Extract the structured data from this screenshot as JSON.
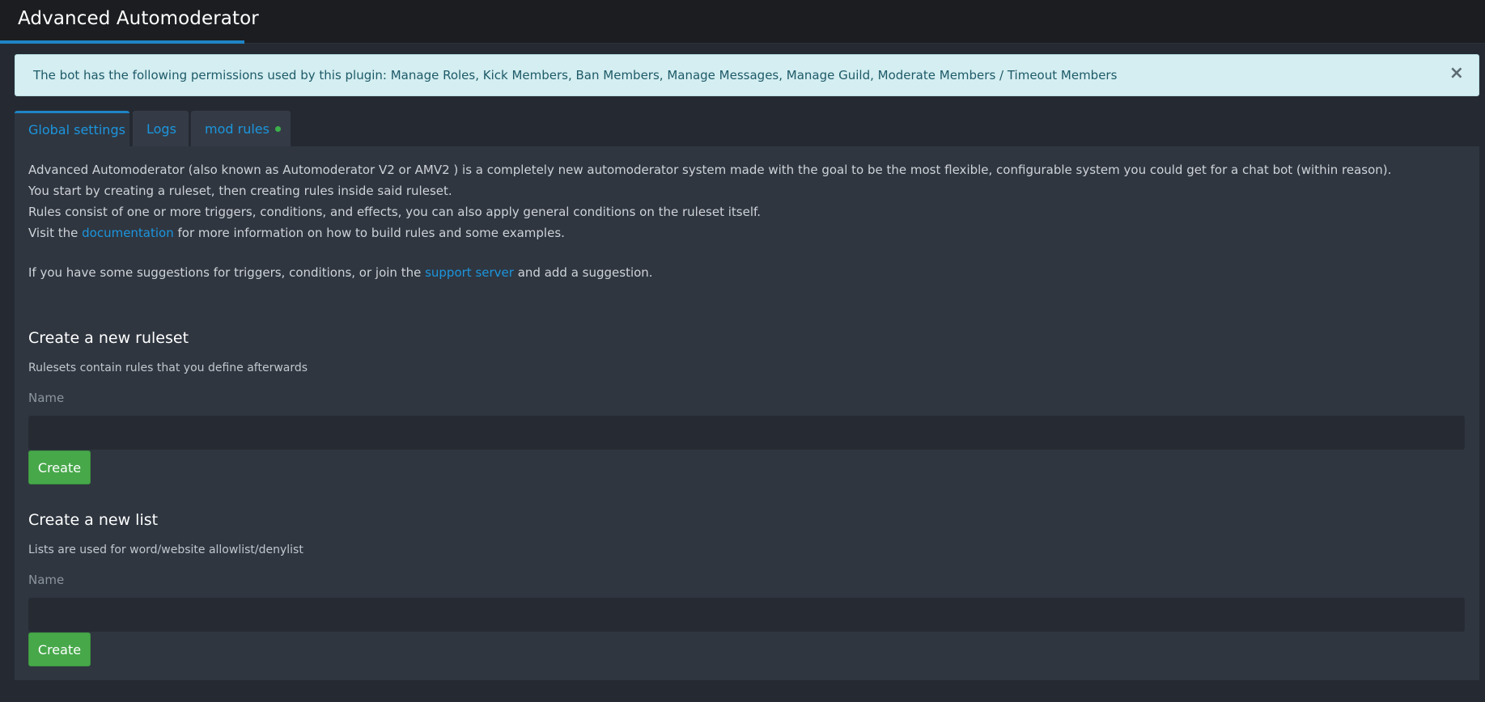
{
  "header": {
    "title": "Advanced Automoderator"
  },
  "alert": {
    "message": "The bot has the following permissions used by this plugin: Manage Roles, Kick Members, Ban Members, Manage Messages, Manage Guild, Moderate Members / Timeout Members",
    "close_glyph": "×"
  },
  "tabs": [
    {
      "label": "Global settings",
      "active": true
    },
    {
      "label": "Logs",
      "active": false
    },
    {
      "label": "mod rules",
      "active": false,
      "status_dot": "green"
    }
  ],
  "intro": {
    "line1": "Advanced Automoderator (also known as Automoderator V2 or AMV2 ) is a completely new automoderator system made with the goal to be the most flexible, configurable system you could get for a chat bot (within reason).",
    "line2": "You start by creating a ruleset, then creating rules inside said ruleset.",
    "line3": "Rules consist of one or more triggers, conditions, and effects, you can also apply general conditions on the ruleset itself.",
    "line4_before": "Visit the ",
    "line4_link": "documentation",
    "line4_after": " for more information on how to build rules and some examples.",
    "line5_before": "If you have some suggestions for triggers, conditions, or join the ",
    "line5_link": "support server",
    "line5_after": " and add a suggestion."
  },
  "ruleset_form": {
    "heading": "Create a new ruleset",
    "description": "Rulesets contain rules that you define afterwards",
    "name_label": "Name",
    "name_value": "",
    "button_label": "Create"
  },
  "list_form": {
    "heading": "Create a new list",
    "description": "Lists are used for word/website allowlist/denylist",
    "name_label": "Name",
    "name_value": "",
    "button_label": "Create"
  },
  "colors": {
    "accent": "#1f84c6",
    "link": "#1c95dd",
    "success": "#47a84a",
    "alert_bg": "#d4eef1"
  }
}
